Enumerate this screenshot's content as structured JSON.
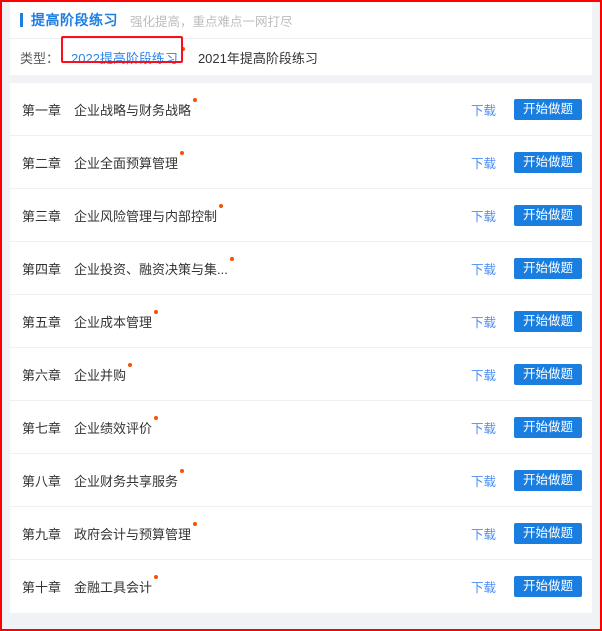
{
  "header": {
    "title": "提高阶段练习",
    "subtitle": "强化提高，重点难点一网打尽"
  },
  "filter": {
    "label": "类型：",
    "tabs": [
      {
        "label": "2022提高阶段练习",
        "active": true,
        "has_dot": true
      },
      {
        "label": "2021年提高阶段练习",
        "active": false,
        "has_dot": false
      }
    ]
  },
  "actions": {
    "download_label": "下载",
    "start_label": "开始做题"
  },
  "colors": {
    "accent_blue": "#1f7fe0",
    "button_blue": "#1a7ee0",
    "link_blue": "#4a8cf7",
    "dot_orange": "#f5510a",
    "annotation_red": "#fc0d1b",
    "page_bg": "#f0f2f5"
  },
  "chapters": [
    {
      "index": "第一章",
      "name": "企业战略与财务战略",
      "has_dot": true
    },
    {
      "index": "第二章",
      "name": "企业全面预算管理",
      "has_dot": true
    },
    {
      "index": "第三章",
      "name": "企业风险管理与内部控制",
      "has_dot": true
    },
    {
      "index": "第四章",
      "name": "企业投资、融资决策与集...",
      "has_dot": true
    },
    {
      "index": "第五章",
      "name": "企业成本管理",
      "has_dot": true
    },
    {
      "index": "第六章",
      "name": "企业并购",
      "has_dot": true
    },
    {
      "index": "第七章",
      "name": "企业绩效评价",
      "has_dot": true
    },
    {
      "index": "第八章",
      "name": "企业财务共享服务",
      "has_dot": true
    },
    {
      "index": "第九章",
      "name": "政府会计与预算管理",
      "has_dot": true
    },
    {
      "index": "第十章",
      "name": "金融工具会计",
      "has_dot": true
    }
  ]
}
